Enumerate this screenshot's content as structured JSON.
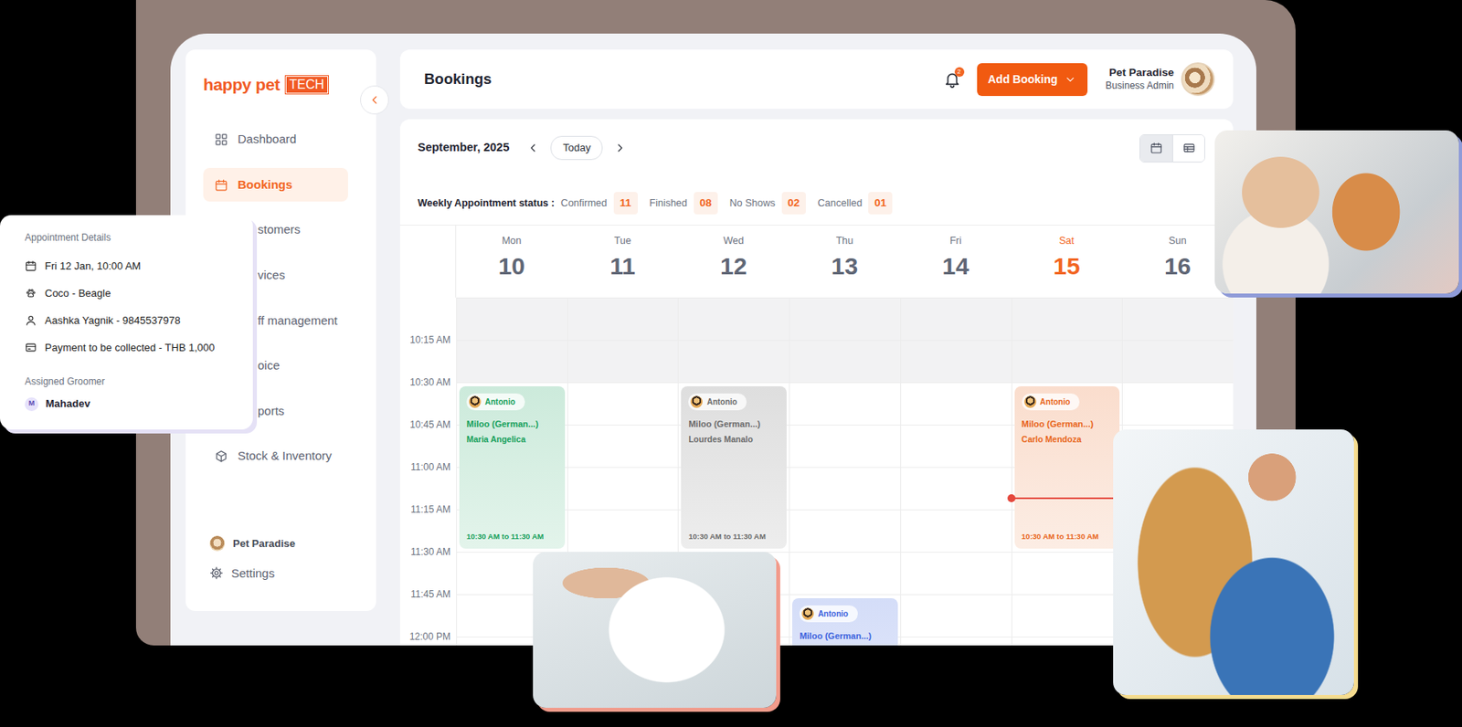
{
  "sidebar": {
    "logo": {
      "name": "happy pet",
      "tag": "TECH"
    },
    "items": [
      {
        "label": "Dashboard",
        "selected": false,
        "kind": "full"
      },
      {
        "label": "Bookings",
        "selected": true,
        "kind": "full"
      },
      {
        "label": "stomers",
        "selected": false,
        "kind": "partial"
      },
      {
        "label": "vices",
        "selected": false,
        "kind": "partial"
      },
      {
        "label": "ff management",
        "selected": false,
        "kind": "partial"
      },
      {
        "label": "oice",
        "selected": false,
        "kind": "partial"
      },
      {
        "label": "ports",
        "selected": false,
        "kind": "partial"
      },
      {
        "label": "Stock & Inventory",
        "selected": false,
        "kind": "full"
      }
    ],
    "business": "Pet Paradise",
    "settings": "Settings"
  },
  "header": {
    "title": "Bookings",
    "notifications": "2",
    "add_button": "Add Booking",
    "account_name": "Pet Paradise",
    "account_role": "Business Admin"
  },
  "calendar": {
    "month": "September, 2025",
    "today_button": "Today",
    "views": [
      {
        "kind": "calendar",
        "selected": true
      },
      {
        "kind": "list",
        "selected": false
      }
    ],
    "status_label": "Weekly Appointment status :",
    "statuses": [
      {
        "label": "Confirmed",
        "count": "11"
      },
      {
        "label": "Finished",
        "count": "08"
      },
      {
        "label": "No Shows",
        "count": "02"
      },
      {
        "label": "Cancelled",
        "count": "01"
      }
    ],
    "days": [
      {
        "name": "Mon",
        "date": "10",
        "today": false
      },
      {
        "name": "Tue",
        "date": "11",
        "today": false
      },
      {
        "name": "Wed",
        "date": "12",
        "today": false
      },
      {
        "name": "Thu",
        "date": "13",
        "today": false
      },
      {
        "name": "Fri",
        "date": "14",
        "today": false
      },
      {
        "name": "Sat",
        "date": "15",
        "today": true
      },
      {
        "name": "Sun",
        "date": "16",
        "today": false
      }
    ],
    "slots": [
      {
        "shaded": true
      },
      {
        "label": "10:15 AM",
        "shaded": true
      },
      {
        "label": "10:30 AM",
        "shaded": false
      },
      {
        "label": "10:45 AM",
        "shaded": false
      },
      {
        "label": "11:00 AM",
        "shaded": false
      },
      {
        "label": "11:15 AM",
        "shaded": false
      },
      {
        "label": "11:30 AM",
        "shaded": false
      },
      {
        "label": "11:45 AM",
        "shaded": false
      },
      {
        "label": "12:00 PM",
        "shaded": false
      }
    ],
    "events": [
      {
        "day": "Mon",
        "start": "10:30 AM",
        "minutes": 60,
        "groomer": "Antonio",
        "pet": "Miloo (German...)",
        "customer": "Maria Angelica",
        "time": "10:30 AM to 11:30 AM",
        "color": "#16a05b"
      },
      {
        "day": "Wed",
        "start": "10:30 AM",
        "minutes": 60,
        "groomer": "Antonio",
        "pet": "Miloo (German...)",
        "customer": "Lourdes Manalo",
        "time": "10:30 AM to 11:30 AM",
        "color": "#6b6b6b"
      },
      {
        "day": "Sat",
        "start": "10:30 AM",
        "minutes": 60,
        "groomer": "Antonio",
        "pet": "Miloo (German...)",
        "customer": "Carlo Mendoza",
        "time": "10:30 AM to 11:30 AM",
        "color": "#e8651a"
      },
      {
        "day": "Thu",
        "start": "11:45 AM",
        "minutes": 60,
        "groomer": "Antonio",
        "pet": "Miloo (German...)",
        "color": "#3d63dd"
      }
    ],
    "now_marker": {
      "day": "Sat",
      "slot": "11:00 AM",
      "level": 0.72
    }
  },
  "popup": {
    "title": "Appointment Details",
    "rows": [
      "Fri 12 Jan, 10:00 AM",
      "Coco - Beagle",
      "Aashka Yagnik - 9845537978",
      "Payment to be collected - THB 1,000"
    ],
    "groomer_label": "Assigned Groomer",
    "groomer_initial": "M",
    "groomer_name": "Mahadev"
  }
}
